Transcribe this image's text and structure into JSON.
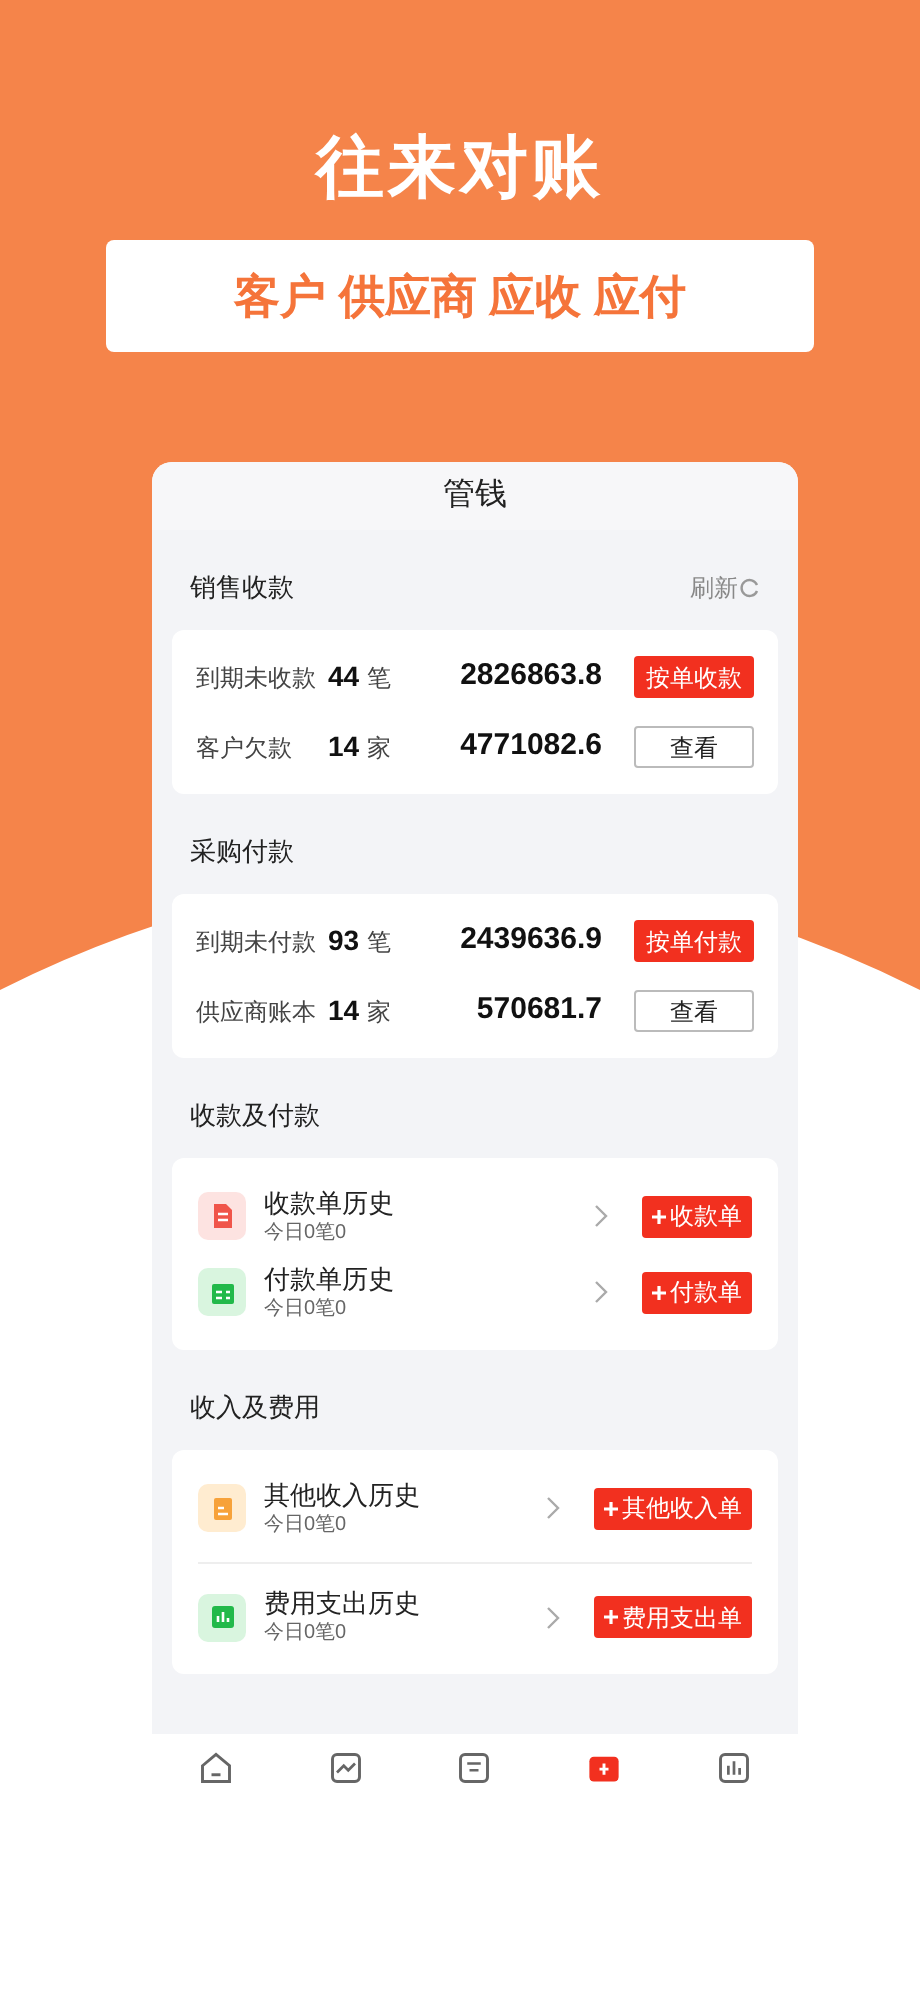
{
  "banner": {
    "title": "往来对账",
    "subtitle": "客户 供应商 应收 应付"
  },
  "screen": {
    "title": "管钱",
    "summaries": [
      {
        "title": "销售收款",
        "refresh": "刷新",
        "rows": [
          {
            "label": "到期未收款",
            "count": "44",
            "unit": "笔",
            "amount": "2826863.8",
            "button": "按单收款",
            "kind": "primary"
          },
          {
            "label": "客户欠款",
            "count": "14",
            "unit": "家",
            "amount": "4771082.6",
            "button": "查看",
            "kind": "outline"
          }
        ]
      },
      {
        "title": "采购付款",
        "rows": [
          {
            "label": "到期未付款",
            "count": "93",
            "unit": "笔",
            "amount": "2439636.9",
            "button": "按单付款",
            "kind": "primary"
          },
          {
            "label": "供应商账本",
            "count": "14",
            "unit": "家",
            "amount": "570681.7",
            "button": "查看",
            "kind": "outline"
          }
        ]
      }
    ],
    "histories": [
      {
        "title": "收款及付款",
        "divided": false,
        "items": [
          {
            "kind": "receipt",
            "title": "收款单历史",
            "sub": "今日0笔0",
            "button": "收款单"
          },
          {
            "kind": "wallet",
            "title": "付款单历史",
            "sub": "今日0笔0",
            "button": "付款单"
          }
        ]
      },
      {
        "title": "收入及费用",
        "divided": true,
        "items": [
          {
            "kind": "doc",
            "title": "其他收入历史",
            "sub": "今日0笔0",
            "button": "其他收入单"
          },
          {
            "kind": "chart",
            "title": "费用支出历史",
            "sub": "今日0笔0",
            "button": "费用支出单"
          }
        ]
      }
    ],
    "tabs": [
      {
        "kind": "home",
        "selected": false
      },
      {
        "kind": "trend",
        "selected": false
      },
      {
        "kind": "tray",
        "selected": false
      },
      {
        "kind": "wallet",
        "selected": true
      },
      {
        "kind": "bars",
        "selected": false
      }
    ]
  }
}
